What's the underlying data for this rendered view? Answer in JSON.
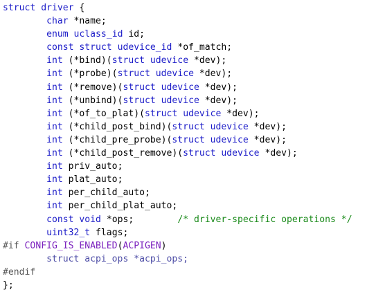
{
  "code": {
    "lines": [
      [
        [
          "kw",
          "struct"
        ],
        [
          "plain",
          " "
        ],
        [
          "type",
          "driver"
        ],
        [
          "plain",
          " {"
        ]
      ],
      [
        [
          "plain",
          "        "
        ],
        [
          "kw",
          "char"
        ],
        [
          "plain",
          " *name;"
        ]
      ],
      [
        [
          "plain",
          "        "
        ],
        [
          "kw",
          "enum"
        ],
        [
          "plain",
          " "
        ],
        [
          "type",
          "uclass_id"
        ],
        [
          "plain",
          " id;"
        ]
      ],
      [
        [
          "plain",
          "        "
        ],
        [
          "kw",
          "const"
        ],
        [
          "plain",
          " "
        ],
        [
          "kw",
          "struct"
        ],
        [
          "plain",
          " "
        ],
        [
          "type",
          "udevice_id"
        ],
        [
          "plain",
          " *of_match;"
        ]
      ],
      [
        [
          "plain",
          "        "
        ],
        [
          "kw",
          "int"
        ],
        [
          "plain",
          " (*bind)("
        ],
        [
          "kw",
          "struct"
        ],
        [
          "plain",
          " "
        ],
        [
          "type",
          "udevice"
        ],
        [
          "plain",
          " *dev);"
        ]
      ],
      [
        [
          "plain",
          "        "
        ],
        [
          "kw",
          "int"
        ],
        [
          "plain",
          " (*probe)("
        ],
        [
          "kw",
          "struct"
        ],
        [
          "plain",
          " "
        ],
        [
          "type",
          "udevice"
        ],
        [
          "plain",
          " *dev);"
        ]
      ],
      [
        [
          "plain",
          "        "
        ],
        [
          "kw",
          "int"
        ],
        [
          "plain",
          " (*remove)("
        ],
        [
          "kw",
          "struct"
        ],
        [
          "plain",
          " "
        ],
        [
          "type",
          "udevice"
        ],
        [
          "plain",
          " *dev);"
        ]
      ],
      [
        [
          "plain",
          "        "
        ],
        [
          "kw",
          "int"
        ],
        [
          "plain",
          " (*unbind)("
        ],
        [
          "kw",
          "struct"
        ],
        [
          "plain",
          " "
        ],
        [
          "type",
          "udevice"
        ],
        [
          "plain",
          " *dev);"
        ]
      ],
      [
        [
          "plain",
          "        "
        ],
        [
          "kw",
          "int"
        ],
        [
          "plain",
          " (*of_to_plat)("
        ],
        [
          "kw",
          "struct"
        ],
        [
          "plain",
          " "
        ],
        [
          "type",
          "udevice"
        ],
        [
          "plain",
          " *dev);"
        ]
      ],
      [
        [
          "plain",
          "        "
        ],
        [
          "kw",
          "int"
        ],
        [
          "plain",
          " (*child_post_bind)("
        ],
        [
          "kw",
          "struct"
        ],
        [
          "plain",
          " "
        ],
        [
          "type",
          "udevice"
        ],
        [
          "plain",
          " *dev);"
        ]
      ],
      [
        [
          "plain",
          "        "
        ],
        [
          "kw",
          "int"
        ],
        [
          "plain",
          " (*child_pre_probe)("
        ],
        [
          "kw",
          "struct"
        ],
        [
          "plain",
          " "
        ],
        [
          "type",
          "udevice"
        ],
        [
          "plain",
          " *dev);"
        ]
      ],
      [
        [
          "plain",
          "        "
        ],
        [
          "kw",
          "int"
        ],
        [
          "plain",
          " (*child_post_remove)("
        ],
        [
          "kw",
          "struct"
        ],
        [
          "plain",
          " "
        ],
        [
          "type",
          "udevice"
        ],
        [
          "plain",
          " *dev);"
        ]
      ],
      [
        [
          "plain",
          "        "
        ],
        [
          "kw",
          "int"
        ],
        [
          "plain",
          " priv_auto;"
        ]
      ],
      [
        [
          "plain",
          "        "
        ],
        [
          "kw",
          "int"
        ],
        [
          "plain",
          " plat_auto;"
        ]
      ],
      [
        [
          "plain",
          "        "
        ],
        [
          "kw",
          "int"
        ],
        [
          "plain",
          " per_child_auto;"
        ]
      ],
      [
        [
          "plain",
          "        "
        ],
        [
          "kw",
          "int"
        ],
        [
          "plain",
          " per_child_plat_auto;"
        ]
      ],
      [
        [
          "plain",
          "        "
        ],
        [
          "kw",
          "const"
        ],
        [
          "plain",
          " "
        ],
        [
          "kw",
          "void"
        ],
        [
          "plain",
          " *ops;        "
        ],
        [
          "comment",
          "/* driver-specific operations */"
        ]
      ],
      [
        [
          "plain",
          "        "
        ],
        [
          "type",
          "uint32_t"
        ],
        [
          "plain",
          " flags;"
        ]
      ],
      [
        [
          "pp",
          "#if"
        ],
        [
          "plain",
          " "
        ],
        [
          "macro",
          "CONFIG_IS_ENABLED"
        ],
        [
          "plain",
          "("
        ],
        [
          "macro",
          "ACPIGEN"
        ],
        [
          "plain",
          ")"
        ]
      ],
      [
        [
          "plain",
          "        "
        ],
        [
          "dim",
          "struct acpi_ops *acpi_ops;"
        ]
      ],
      [
        [
          "pp",
          "#endif"
        ]
      ],
      [
        [
          "plain",
          "};"
        ]
      ]
    ]
  }
}
